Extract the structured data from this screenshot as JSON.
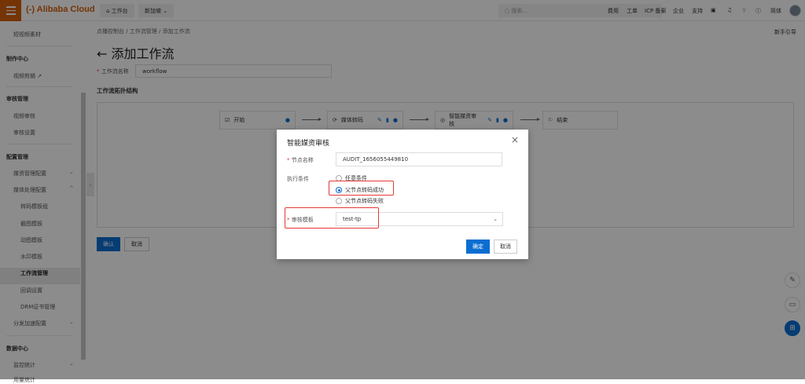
{
  "header": {
    "logo": "(-) Alibaba Cloud",
    "workbench": "工作台",
    "region": "新加坡",
    "search_placeholder": "搜索...",
    "links": [
      "费用",
      "工单",
      "ICP 备案",
      "企业",
      "支持"
    ],
    "lang": "简体"
  },
  "sidebar": {
    "items": [
      {
        "label": "短视频素材",
        "type": "item"
      },
      {
        "label": "制作中心",
        "type": "head"
      },
      {
        "label": "视频剪辑 ↗",
        "type": "item"
      },
      {
        "label": "审核管理",
        "type": "head"
      },
      {
        "label": "视频审核",
        "type": "item"
      },
      {
        "label": "审核设置",
        "type": "item"
      },
      {
        "label": "配置管理",
        "type": "head"
      },
      {
        "label": "媒资管理配置",
        "type": "item",
        "chevron": "down"
      },
      {
        "label": "媒体处理配置",
        "type": "item",
        "chevron": "up"
      },
      {
        "label": "转码模板组",
        "type": "sub"
      },
      {
        "label": "截图模板",
        "type": "sub"
      },
      {
        "label": "动图模板",
        "type": "sub"
      },
      {
        "label": "水印模板",
        "type": "sub"
      },
      {
        "label": "工作流管理",
        "type": "sub",
        "active": true
      },
      {
        "label": "回调设置",
        "type": "sub"
      },
      {
        "label": "DRM证书管理",
        "type": "sub"
      },
      {
        "label": "分发加速配置",
        "type": "item",
        "chevron": "down"
      },
      {
        "label": "数据中心",
        "type": "head"
      },
      {
        "label": "监控统计",
        "type": "item",
        "chevron": "down"
      },
      {
        "label": "用量统计",
        "type": "item"
      }
    ]
  },
  "main": {
    "breadcrumb": "点播控制台  /  工作流管理  /  添加工作流",
    "guide": "新手引导",
    "title": "← 添加工作流",
    "name_label": "工作流名称",
    "name_value": "workflow",
    "topology_label": "工作流拓扑结构",
    "nodes": [
      "开始",
      "媒体转码",
      "智能媒资审核",
      "结束"
    ],
    "confirm": "确认",
    "cancel": "取消"
  },
  "modal": {
    "title": "智能媒资审核",
    "node_name_label": "节点名称",
    "node_name_value": "AUDIT_1656055449810",
    "condition_label": "执行条件",
    "conditions": [
      "任意条件",
      "父节点转码成功",
      "父节点转码失败"
    ],
    "selected_condition": 1,
    "template_label": "审核模板",
    "template_value": "test-tp",
    "ok": "确定",
    "cancel": "取消"
  },
  "colors": {
    "brand": "#d5600a",
    "primary": "#0a6ed1",
    "highlight": "#e53935"
  }
}
